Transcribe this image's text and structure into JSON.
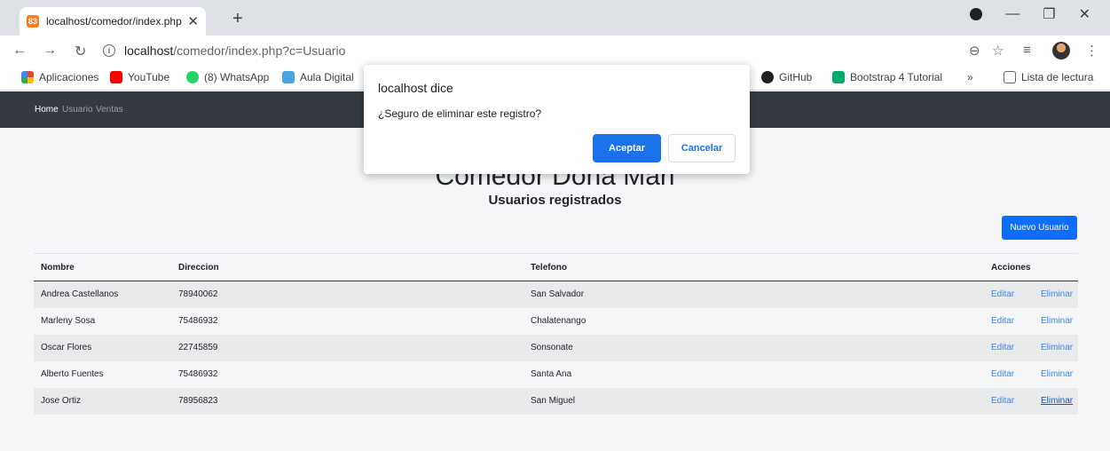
{
  "browser": {
    "tab_title": "localhost/comedor/index.php?c=",
    "tab_favicon_text": "83",
    "url_host": "localhost",
    "url_path": "/comedor/index.php?c=Usuario"
  },
  "bookmarks": {
    "apps": "Aplicaciones",
    "youtube": "YouTube",
    "whatsapp": "(8) WhatsApp",
    "aula": "Aula Digital",
    "github": "GitHub",
    "bootstrap": "Bootstrap 4 Tutorial",
    "more": "»",
    "reading_list": "Lista de lectura"
  },
  "navbar": {
    "items": [
      {
        "label": "Home"
      },
      {
        "label": "Usuario"
      },
      {
        "label": "Ventas"
      }
    ]
  },
  "page": {
    "title": "Comedor Doña Mari",
    "subtitle": "Usuarios registrados",
    "new_button": "Nuevo Usuario"
  },
  "table": {
    "headers": [
      "Nombre",
      "Direccion",
      "Telefono",
      "Acciones"
    ],
    "edit_label": "Editar",
    "delete_label": "Eliminar",
    "rows": [
      {
        "nombre": "Andrea Castellanos",
        "direccion": "78940062",
        "telefono": "San Salvador"
      },
      {
        "nombre": "Marleny Sosa",
        "direccion": "75486932",
        "telefono": "Chalatenango"
      },
      {
        "nombre": "Oscar Flores",
        "direccion": "22745859",
        "telefono": "Sonsonate"
      },
      {
        "nombre": "Alberto Fuentes",
        "direccion": "75486932",
        "telefono": "Santa Ana"
      },
      {
        "nombre": "Jose Ortiz",
        "direccion": "78956823",
        "telefono": "San Miguel"
      }
    ]
  },
  "dialog": {
    "title": "localhost dice",
    "message": "¿Seguro de eliminar este registro?",
    "ok": "Aceptar",
    "cancel": "Cancelar"
  },
  "colors": {
    "navbar": "#343a40",
    "primary": "#0d6efd",
    "dialog_button": "#1a73e8"
  }
}
